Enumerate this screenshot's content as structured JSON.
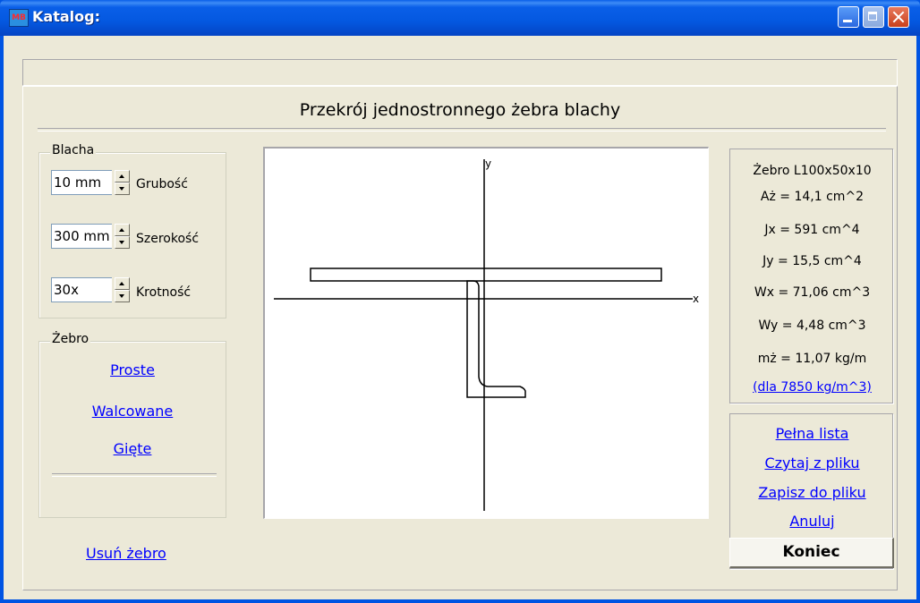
{
  "window": {
    "title": "Katalog:",
    "app_icon_text": "MB"
  },
  "heading": "Przekrój jednostronnego żebra blachy",
  "blacha": {
    "group_title": "Blacha",
    "fields": [
      {
        "value": "10 mm",
        "label": "Grubość"
      },
      {
        "value": "300 mm",
        "label": "Szerokość"
      },
      {
        "value": "30x",
        "label": "Krotność"
      }
    ]
  },
  "zebro": {
    "group_title": "Żebro",
    "links": [
      "Proste",
      "Walcowane",
      "Gięte"
    ]
  },
  "remove_link": "Usuń żebro",
  "drawing": {
    "axis_x_label": "x",
    "axis_y_label": "y"
  },
  "properties": {
    "lines": [
      "Żebro L100x50x10",
      "Aż = 14,1 cm^2",
      "Jx = 591 cm^4",
      "Jy = 15,5 cm^4",
      "Wx = 71,06 cm^3",
      "Wy = 4,48 cm^3",
      "mż = 11,07 kg/m"
    ],
    "density_link": "(dla 7850 kg/m^3)"
  },
  "actions": {
    "links": [
      "Pełna lista",
      "Czytaj z pliku",
      "Zapisz do pliku",
      "Anuluj"
    ],
    "end_button": "Koniec"
  }
}
